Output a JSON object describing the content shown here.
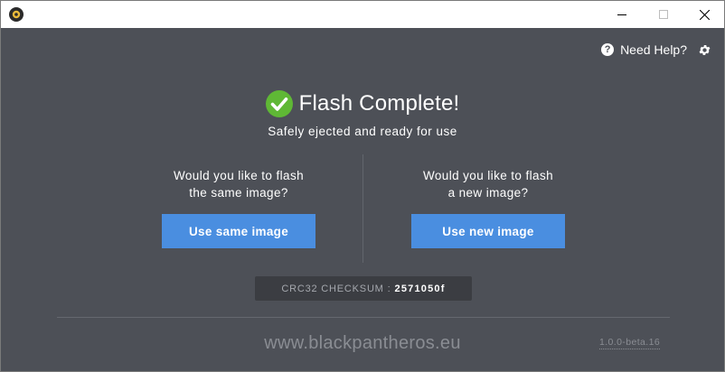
{
  "window": {
    "minimize_icon": "minimize-icon",
    "maximize_icon": "maximize-icon",
    "close_icon": "close-icon"
  },
  "header": {
    "help_label": "Need Help?",
    "help_icon": "question-icon",
    "settings_icon": "gear-icon"
  },
  "main": {
    "title": "Flash Complete!",
    "title_icon": "checkmark-circle-icon",
    "subtitle": "Safely ejected and ready for use",
    "same_image": {
      "question": "Would you like to flash\nthe same image?",
      "button_label": "Use same image"
    },
    "new_image": {
      "question": "Would you like to flash\na new image?",
      "button_label": "Use new image"
    },
    "checksum": {
      "label": "CRC32 CHECKSUM",
      "separator": ":",
      "value": "2571050f"
    }
  },
  "footer": {
    "website": "www.blackpantheros.eu",
    "version": "1.0.0-beta.16"
  },
  "colors": {
    "background": "#4d5057",
    "accent": "#4a8ee0",
    "success": "#5fb835",
    "checksum_bg": "#3b3d42"
  }
}
